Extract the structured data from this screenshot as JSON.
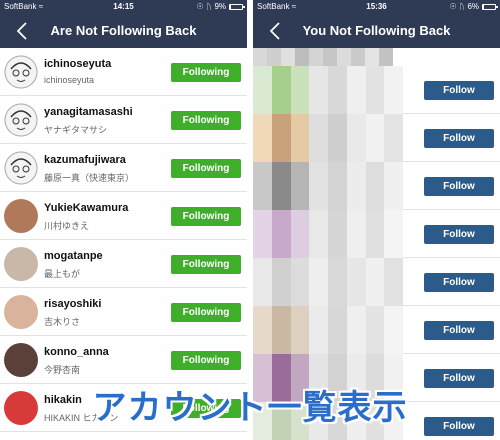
{
  "left": {
    "status": {
      "carrier": "SoftBank",
      "time": "14:15",
      "battery": "9%",
      "battery_level": 0.09
    },
    "title": "Are Not Following Back",
    "button_label": "Following",
    "users": [
      {
        "username": "ichinoseyuta",
        "display": "ichinoseyuta",
        "avatar_color": "#f4f4f4"
      },
      {
        "username": "yanagitamasashi",
        "display": "ヤナギタマサシ",
        "avatar_color": "#f4f4f4"
      },
      {
        "username": "kazumafujiwara",
        "display": "藤原一真（快速東京）",
        "avatar_color": "#f4f4f4"
      },
      {
        "username": "YukieKawamura",
        "display": "川村ゆきえ",
        "avatar_color": "#b07a5a"
      },
      {
        "username": "mogatanpe",
        "display": "最上もが",
        "avatar_color": "#c9b7a8"
      },
      {
        "username": "risayoshiki",
        "display": "吉木りさ",
        "avatar_color": "#d9b39c"
      },
      {
        "username": "konno_anna",
        "display": "今野杏南",
        "avatar_color": "#5a4038"
      },
      {
        "username": "hikakin",
        "display": "HIKAKIN ヒカキン",
        "avatar_color": "#d83a3a"
      }
    ]
  },
  "right": {
    "status": {
      "carrier": "SoftBank",
      "time": "15:36",
      "battery": "6%",
      "battery_level": 0.06
    },
    "title": "You Not Following Back",
    "button_label": "Follow",
    "row_count": 8
  },
  "caption": "アカウント一覧表示",
  "colors": {
    "navbar": "#2f3a55",
    "following_green": "#3fae2a",
    "follow_blue": "#2b5b8b",
    "caption_blue": "#2a6ecb"
  },
  "icons": {
    "back": "chevron-left-icon",
    "wifi": "wifi-icon",
    "lock": "orientation-lock-icon",
    "bluetooth": "bluetooth-icon",
    "battery": "battery-icon"
  }
}
